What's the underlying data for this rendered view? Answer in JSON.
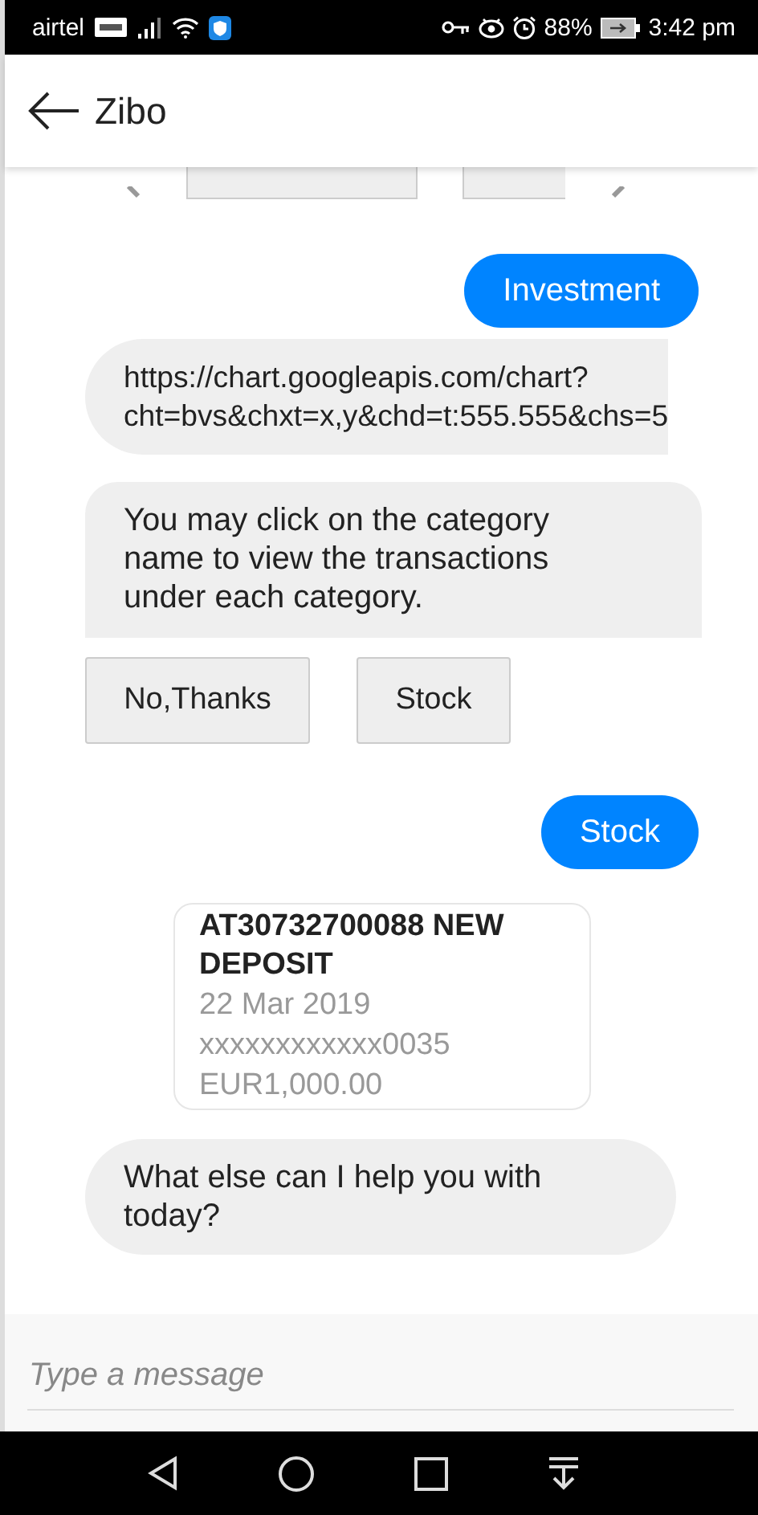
{
  "status_bar": {
    "carrier": "airtel",
    "battery": "88%",
    "time": "3:42 pm"
  },
  "header": {
    "title": "Zibo"
  },
  "messages": [
    {
      "kind": "user",
      "text": "Investment"
    },
    {
      "kind": "bot",
      "text": "https://chart.googleapis.com/chart?\ncht=bvs&chxt=x,y&chd=t:555.555&chs=5"
    },
    {
      "kind": "bot",
      "text": "You may click on the category name to view the transactions under each category."
    },
    {
      "kind": "quick_replies",
      "options": [
        "No,Thanks",
        "Stock"
      ]
    },
    {
      "kind": "user",
      "text": "Stock"
    },
    {
      "kind": "card",
      "title": "AT30732700088 NEW DEPOSIT",
      "lines": [
        "22 Mar 2019",
        "xxxxxxxxxxxx0035",
        "EUR1,000.00"
      ]
    },
    {
      "kind": "bot",
      "text": "What else can I help you with today?"
    }
  ],
  "composer": {
    "placeholder": "Type a message"
  }
}
